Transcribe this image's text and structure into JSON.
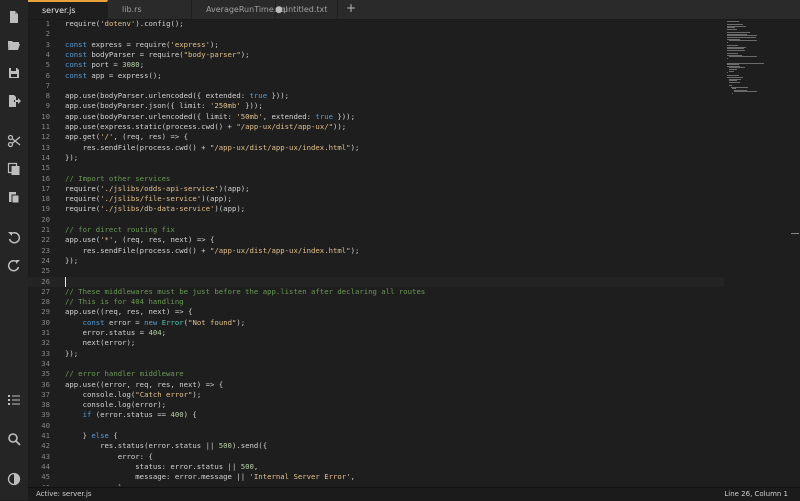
{
  "tabs": [
    {
      "label": "server.js",
      "active": true,
      "dirty": false
    },
    {
      "label": "lib.rs",
      "active": false,
      "dirty": false
    },
    {
      "label": "AverageRunTime.sql",
      "active": false,
      "dirty": false
    },
    {
      "label": "untitled.txt",
      "active": false,
      "dirty": true
    }
  ],
  "tab_add_symbol": "+",
  "sidebar_icons": [
    "file-icon",
    "folder-open-icon",
    "save-icon",
    "export-icon",
    "scissors-icon",
    "copy-icon",
    "paste-icon",
    "undo-icon",
    "redo-icon",
    "list-icon",
    "search-icon",
    "theme-icon"
  ],
  "colors": {
    "accent": "#e6a23c",
    "keyword": "#569cd6",
    "string": "#e2c08d",
    "number": "#b5cea8",
    "comment": "#6a9955"
  },
  "editor": {
    "current_line": 26,
    "lines": [
      {
        "n": "1",
        "c": "require('dotenv').config();"
      },
      {
        "n": "2",
        "c": ""
      },
      {
        "n": "3",
        "c": "const express = require('express');"
      },
      {
        "n": "4",
        "c": "const bodyParser = require(\"body-parser\");"
      },
      {
        "n": "5",
        "c": "const port = 3080;"
      },
      {
        "n": "6",
        "c": "const app = express();"
      },
      {
        "n": "7",
        "c": ""
      },
      {
        "n": "8",
        "c": "app.use(bodyParser.urlencoded({ extended: true }));"
      },
      {
        "n": "9",
        "c": "app.use(bodyParser.json({ limit: '250mb' }));"
      },
      {
        "n": "10",
        "c": "app.use(bodyParser.urlencoded({ limit: '50mb', extended: true }));"
      },
      {
        "n": "11",
        "c": "app.use(express.static(process.cwd() + \"/app-ux/dist/app-ux/\"));"
      },
      {
        "n": "12",
        "c": "app.get('/', (req, res) => {"
      },
      {
        "n": "13",
        "c": "    res.sendFile(process.cwd() + \"/app-ux/dist/app-ux/index.html\");"
      },
      {
        "n": "14",
        "c": "});"
      },
      {
        "n": "15",
        "c": ""
      },
      {
        "n": "16",
        "c": "// Import other services"
      },
      {
        "n": "17",
        "c": "require('./jslibs/odds-api-service')(app);"
      },
      {
        "n": "18",
        "c": "require('./jslibs/file-service')(app);"
      },
      {
        "n": "19",
        "c": "require('./jslibs/db-data-service')(app);"
      },
      {
        "n": "20",
        "c": ""
      },
      {
        "n": "21",
        "c": "// for direct routing fix"
      },
      {
        "n": "22",
        "c": "app.use('*', (req, res, next) => {"
      },
      {
        "n": "23",
        "c": "    res.sendFile(process.cwd() + \"/app-ux/dist/app-ux/index.html\");"
      },
      {
        "n": "24",
        "c": "});"
      },
      {
        "n": "25",
        "c": ""
      },
      {
        "n": "26",
        "c": ""
      },
      {
        "n": "27",
        "c": "// These middlewares must be just before the app.listen after declaring all routes"
      },
      {
        "n": "28",
        "c": "// This is for 404 handling"
      },
      {
        "n": "29",
        "c": "app.use((req, res, next) => {"
      },
      {
        "n": "30",
        "c": "    const error = new Error(\"Not found\");"
      },
      {
        "n": "31",
        "c": "    error.status = 404;"
      },
      {
        "n": "32",
        "c": "    next(error);"
      },
      {
        "n": "33",
        "c": "});"
      },
      {
        "n": "34",
        "c": ""
      },
      {
        "n": "35",
        "c": "// error handler middleware"
      },
      {
        "n": "36",
        "c": "app.use((error, req, res, next) => {"
      },
      {
        "n": "37",
        "c": "    console.log(\"Catch error\");"
      },
      {
        "n": "38",
        "c": "    console.log(error);"
      },
      {
        "n": "39",
        "c": "    if (error.status == 400) {"
      },
      {
        "n": "40",
        "c": ""
      },
      {
        "n": "41",
        "c": "    } else {"
      },
      {
        "n": "42",
        "c": "        res.status(error.status || 500).send({"
      },
      {
        "n": "43",
        "c": "            error: {"
      },
      {
        "n": "44",
        "c": "                status: error.status || 500,"
      },
      {
        "n": "45",
        "c": "                message: error.message || 'Internal Server Error',"
      },
      {
        "n": "46",
        "c": "            },"
      }
    ]
  },
  "status": {
    "left": "Active: server.js",
    "right": "Line 26, Column 1"
  }
}
